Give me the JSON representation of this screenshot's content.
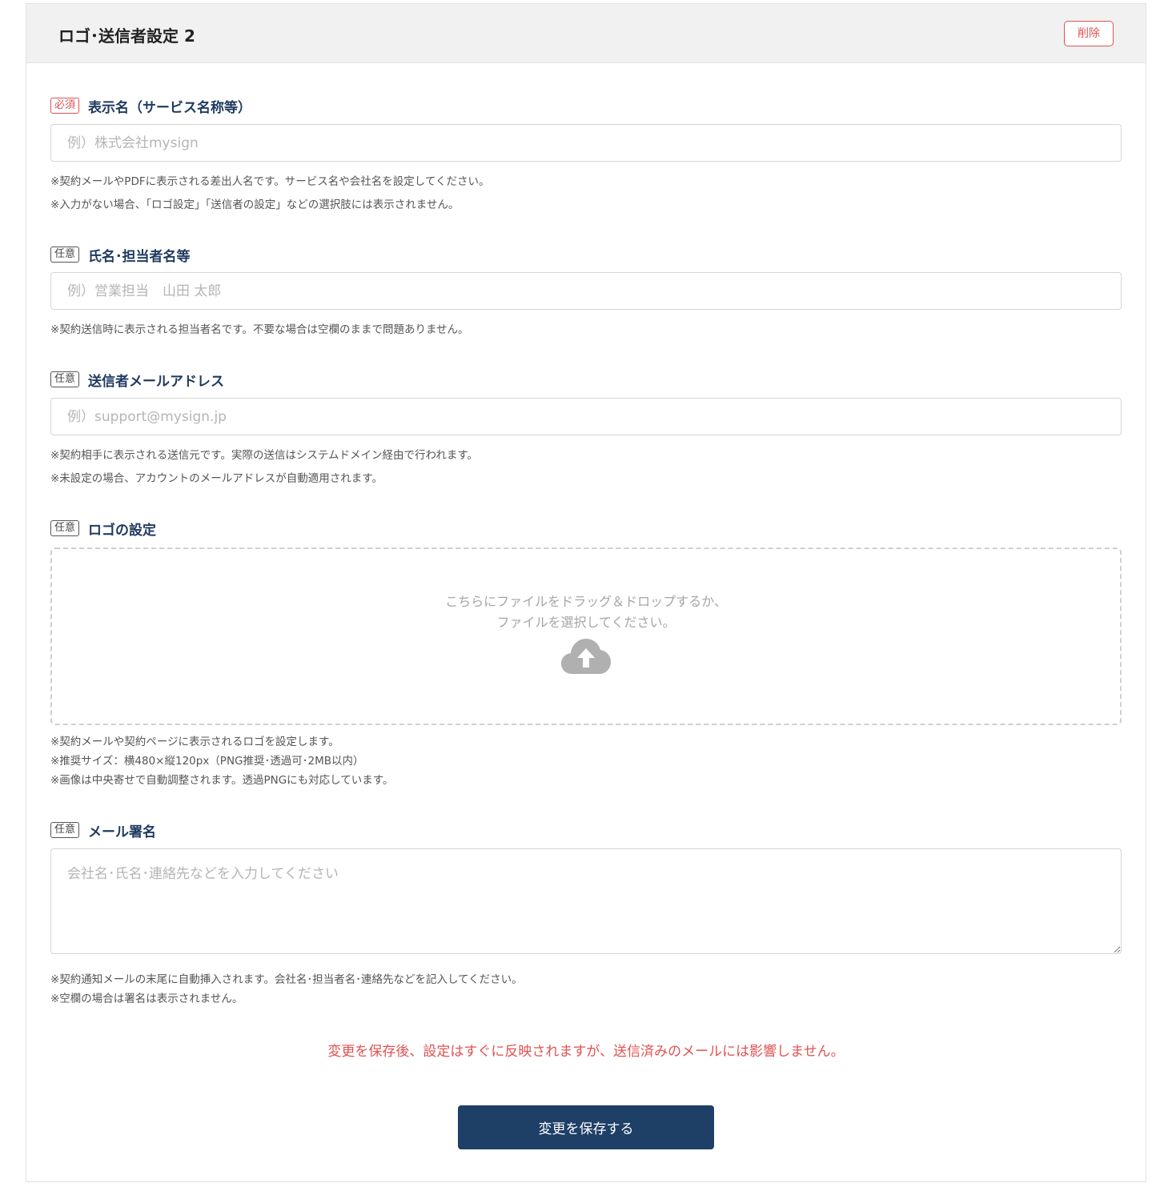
{
  "header": {
    "title": "ロゴ･送信者設定 2",
    "delete_label": "削除"
  },
  "fields": {
    "display_name": {
      "badge": "必須",
      "label": "表示名（サービス名称等）",
      "placeholder": "例）株式会社mysign",
      "help": [
        "※契約メールやPDFに表示される差出人名です。サービス名や会社名を設定してください。",
        "※入力がない場合、「ロゴ設定」「送信者の設定」などの選択肢には表示されません。"
      ]
    },
    "person_name": {
      "badge": "任意",
      "label": "氏名･担当者名等",
      "placeholder": "例）営業担当　山田 太郎",
      "help": [
        "※契約送信時に表示される担当者名です。不要な場合は空欄のままで問題ありません。"
      ]
    },
    "sender_email": {
      "badge": "任意",
      "label": "送信者メールアドレス",
      "placeholder": "例）support@mysign.jp",
      "help": [
        "※契約相手に表示される送信元です。実際の送信はシステムドメイン経由で行われます。",
        "※未設定の場合、アカウントのメールアドレスが自動適用されます。"
      ]
    },
    "logo": {
      "badge": "任意",
      "label": "ロゴの設定",
      "dropzone_line1": "こちらにファイルをドラッグ＆ドロップするか、",
      "dropzone_line2": "ファイルを選択してください。",
      "icon": "cloud-upload-icon",
      "help": [
        "※契約メールや契約ページに表示されるロゴを設定します。",
        "※推奨サイズ：横480×縦120px（PNG推奨･透過可･2MB以内）",
        "※画像は中央寄せで自動調整されます。透過PNGにも対応しています。"
      ]
    },
    "signature": {
      "badge": "任意",
      "label": "メール署名",
      "placeholder": "会社名･氏名･連絡先などを入力してください",
      "help": [
        "※契約通知メールの末尾に自動挿入されます。会社名･担当者名･連絡先などを記入してください。",
        "※空欄の場合は署名は表示されません。"
      ]
    }
  },
  "notice": "変更を保存後、設定はすぐに反映されますが、送信済みのメールには影響しません。",
  "save_label": "変更を保存する",
  "colors": {
    "accent_navy": "#1e3f66",
    "required_red": "#e05252",
    "label_navy": "#1f3a5f"
  }
}
